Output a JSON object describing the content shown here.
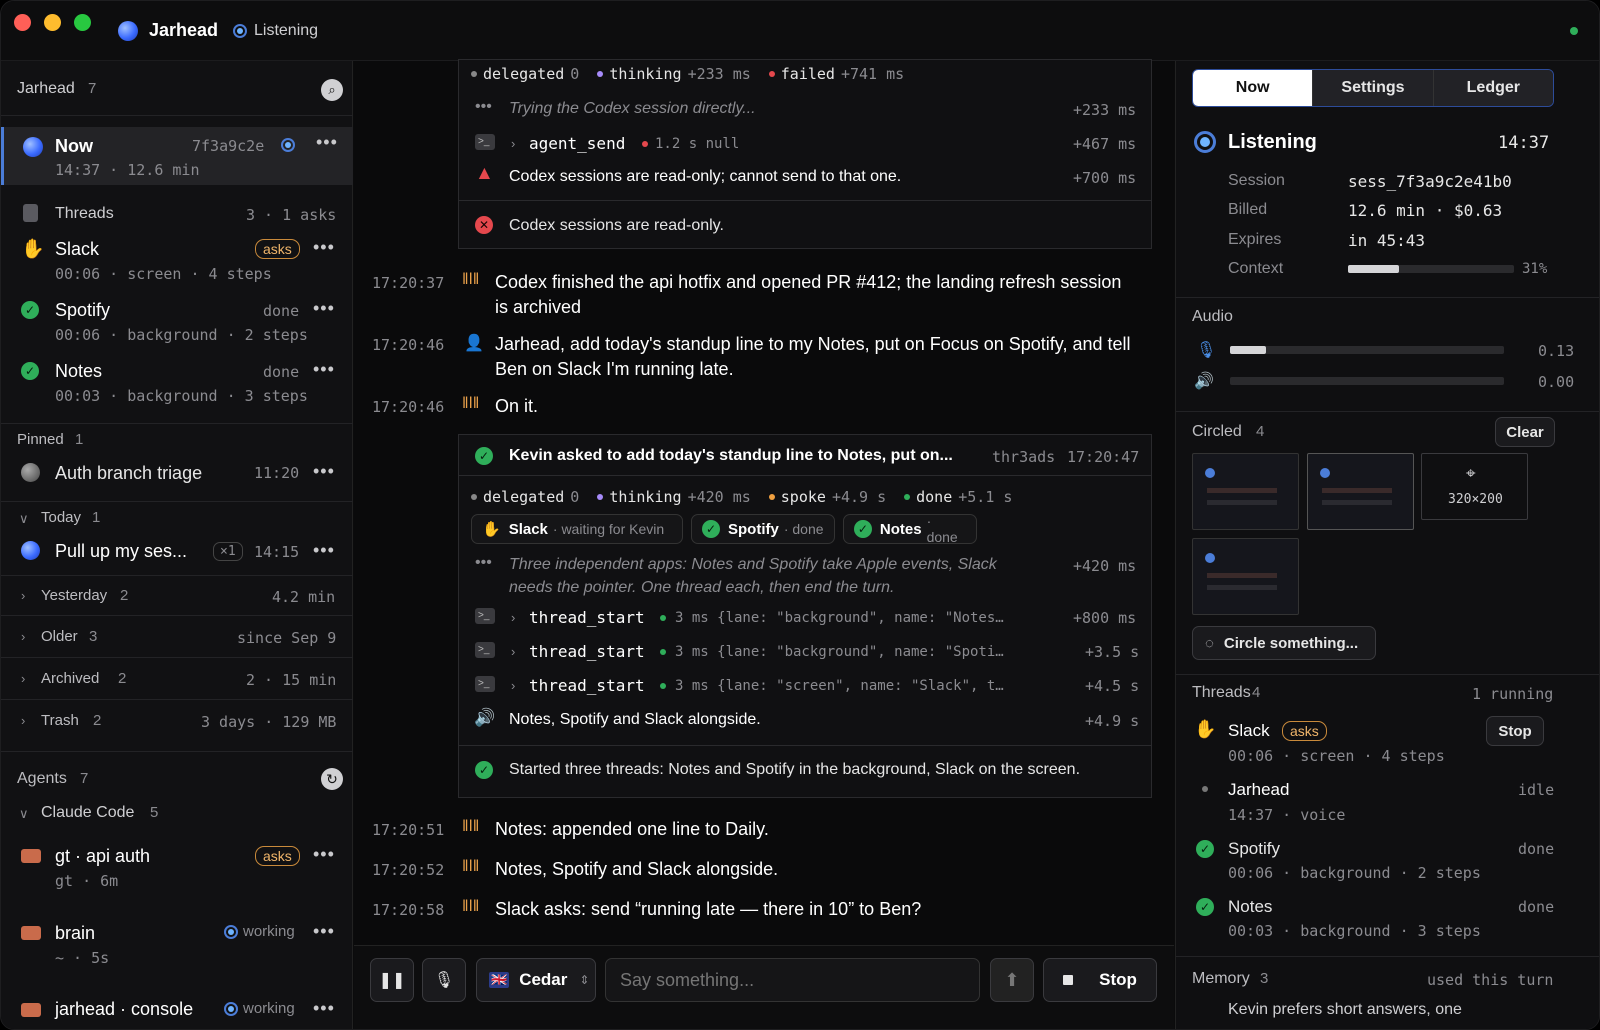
{
  "app": {
    "title": "Jarhead",
    "status": "Listening"
  },
  "sidebar": {
    "header": {
      "label": "Jarhead",
      "count": "7"
    },
    "now": {
      "label": "Now",
      "hash": "7f3a9c2e",
      "meta": "14:37 · 12.6 min"
    },
    "threads_header": {
      "label": "Threads",
      "meta": "3 · 1 asks"
    },
    "threads": [
      {
        "name": "Slack",
        "badge": "asks",
        "meta": "00:06 · screen · 4 steps"
      },
      {
        "name": "Spotify",
        "state": "done",
        "meta": "00:06 · background · 2 steps"
      },
      {
        "name": "Notes",
        "state": "done",
        "meta": "00:03 · background · 3 steps"
      }
    ],
    "pinned": {
      "label": "Pinned",
      "count": "1",
      "item": "Auth branch triage",
      "time": "11:20"
    },
    "today": {
      "label": "Today",
      "count": "1",
      "item": "Pull up my ses...",
      "badge": "×1",
      "time": "14:15"
    },
    "groups": [
      {
        "label": "Yesterday",
        "count": "2",
        "meta": "4.2 min"
      },
      {
        "label": "Older",
        "count": "3",
        "meta": "since Sep 9"
      },
      {
        "label": "Archived",
        "count": "2",
        "meta": "2 · 15 min"
      },
      {
        "label": "Trash",
        "count": "2",
        "meta": "3 days · 129 MB"
      }
    ],
    "agents": {
      "label": "Agents",
      "count": "7"
    },
    "claude": {
      "label": "Claude Code",
      "count": "5"
    },
    "agent_items": [
      {
        "name": "gt · api auth",
        "badge": "asks",
        "meta": "gt · 6m"
      },
      {
        "name": "brain",
        "state": "working",
        "meta": "~ · 5s"
      },
      {
        "name": "jarhead · console",
        "state": "working"
      }
    ]
  },
  "center": {
    "card1": {
      "stats": [
        "delegated",
        "0",
        "thinking",
        "+233 ms",
        "failed",
        "+741 ms"
      ],
      "thought": "Trying the Codex session directly...",
      "thought_t": "+233 ms",
      "tool": "agent_send",
      "tool_meta": "1.2 s null",
      "tool_t": "+467 ms",
      "warn": "Codex sessions are read-only; cannot send to that one.",
      "warn_t": "+700 ms",
      "result": "Codex sessions are read-only."
    },
    "msgs": [
      {
        "time": "17:20:37",
        "text": "Codex finished the api hotfix and opened PR #412; the landing refresh session",
        "text2": "is archived"
      },
      {
        "time": "17:20:46",
        "text": "Jarhead, add today's standup line to my Notes, put on Focus on Spotify, and tell",
        "text2": "Ben on Slack I'm running late."
      },
      {
        "time": "17:20:46",
        "text": "On it."
      }
    ],
    "card2": {
      "title": "Kevin asked to add today's standup line to Notes, put on...",
      "id": "thr3ads",
      "time": "17:20:47",
      "stats": [
        "delegated",
        "0",
        "thinking",
        "+420 ms",
        "spoke",
        "+4.9 s",
        "done",
        "+5.1 s"
      ],
      "chips": [
        {
          "name": "Slack",
          "state": "· waiting for Kevin"
        },
        {
          "name": "Spotify",
          "state": "· done"
        },
        {
          "name": "Notes",
          "state": "· done"
        }
      ],
      "thought": "Three independent apps: Notes and Spotify take Apple events, Slack",
      "thought2": "needs the pointer. One thread each, then end the turn.",
      "thought_t": "+420 ms",
      "tools": [
        {
          "name": "thread_start",
          "meta": "3 ms {lane: \"background\", name: \"Notes…",
          "t": "+800 ms"
        },
        {
          "name": "thread_start",
          "meta": "3 ms {lane: \"background\", name: \"Spoti…",
          "t": "+3.5 s"
        },
        {
          "name": "thread_start",
          "meta": "3 ms {lane: \"screen\", name: \"Slack\", t…",
          "t": "+4.5 s"
        }
      ],
      "spoke": "Notes, Spotify and Slack alongside.",
      "spoke_t": "+4.9 s",
      "result": "Started three threads: Notes and Spotify in the background, Slack on the screen."
    },
    "msgs2": [
      {
        "time": "17:20:51",
        "text": "Notes: appended one line to Daily."
      },
      {
        "time": "17:20:52",
        "text": "Notes, Spotify and Slack alongside."
      },
      {
        "time": "17:20:58",
        "text": "Slack asks: send “running late — there in 10” to Ben?"
      }
    ],
    "composer": {
      "voice": "Cedar",
      "placeholder": "Say something...",
      "stop": "Stop"
    }
  },
  "right": {
    "tabs": [
      "Now",
      "Settings",
      "Ledger"
    ],
    "status": {
      "label": "Listening",
      "time": "14:37"
    },
    "info": [
      {
        "k": "Session",
        "v": "sess_7f3a9c2e41b0"
      },
      {
        "k": "Billed",
        "v": "12.6 min · $0.63"
      },
      {
        "k": "Expires",
        "v": "in 45:43"
      },
      {
        "k": "Context",
        "v": "31%"
      }
    ],
    "context_level": 0.31,
    "audio": {
      "label": "Audio",
      "mic": "0.13",
      "mic_level": 0.13,
      "spk": "0.00",
      "spk_level": 0.0
    },
    "circled": {
      "label": "Circled",
      "count": "4",
      "clear": "Clear",
      "size": "320×200",
      "action": "Circle something..."
    },
    "threads": {
      "label": "Threads",
      "count": "4",
      "meta": "1 running",
      "stop": "Stop",
      "items": [
        {
          "name": "Slack",
          "badge": "asks",
          "meta": "00:06 · screen · 4 steps"
        },
        {
          "name": "Jarhead",
          "state": "idle",
          "meta": "14:37 · voice"
        },
        {
          "name": "Spotify",
          "state": "done",
          "meta": "00:06 · background · 2 steps"
        },
        {
          "name": "Notes",
          "state": "done",
          "meta": "00:03 · background · 3 steps"
        }
      ]
    },
    "memory": {
      "label": "Memory",
      "count": "3",
      "meta": "used this turn",
      "item": "Kevin prefers short answers, one"
    }
  },
  "colors": {
    "accent": "#3b6bff",
    "asks": "#f0b56a",
    "done": "#2fae5a",
    "danger": "#e5484d"
  }
}
